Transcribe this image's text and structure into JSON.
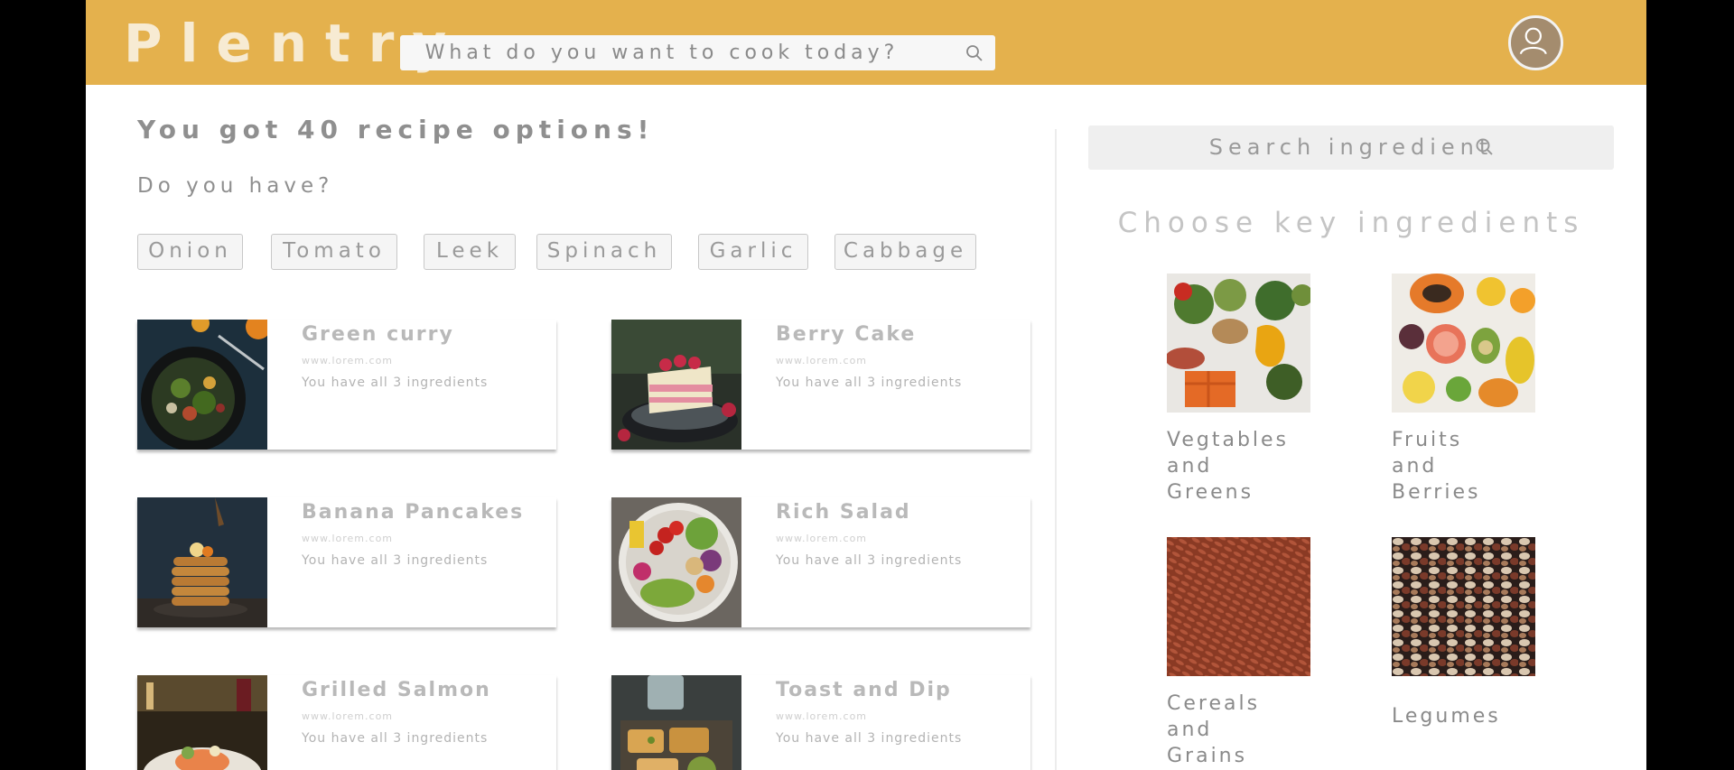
{
  "header": {
    "logo": "Plentry",
    "search_placeholder": "What do you want to cook today?",
    "brand_color": "#e4b14d"
  },
  "main": {
    "headline": "You got 40 recipe options!",
    "question": "Do you have?",
    "chips": [
      "Onion",
      "Tomato",
      "Leek",
      "Spinach",
      "Garlic",
      "Cabbage"
    ],
    "recipes": [
      {
        "title": "Green curry",
        "url": "www.lorem.com",
        "note": "You have all 3 ingredients"
      },
      {
        "title": "Berry Cake",
        "url": "www.lorem.com",
        "note": "You have all 3 ingredients"
      },
      {
        "title": "Banana Pancakes",
        "url": "www.lorem.com",
        "note": "You have all 3 ingredients"
      },
      {
        "title": "Rich Salad",
        "url": "www.lorem.com",
        "note": "You have all 3 ingredients"
      },
      {
        "title": "Grilled Salmon",
        "url": "www.lorem.com",
        "note": "You have all 3 ingredients"
      },
      {
        "title": "Toast and Dip",
        "url": "www.lorem.com",
        "note": "You have all 3 ingredients"
      }
    ]
  },
  "sidebar": {
    "search_placeholder": "Search ingredient",
    "heading": "Choose key ingredients",
    "categories": [
      {
        "line1": "Vegtables",
        "line2": "and",
        "line3": "Greens"
      },
      {
        "line1": "Fruits",
        "line2": "and",
        "line3": "Berries"
      },
      {
        "line1": "Cereals",
        "line2": "and",
        "line3": "Grains"
      },
      {
        "line1": "Legumes",
        "line2": "",
        "line3": ""
      }
    ]
  }
}
